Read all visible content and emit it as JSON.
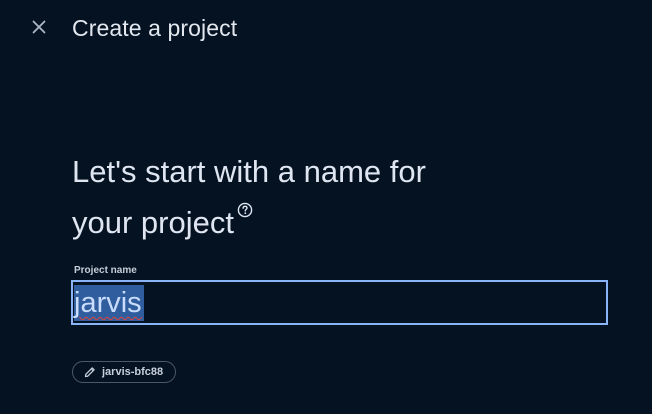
{
  "topbar": {
    "title": "Create a project",
    "close_icon": "close-icon"
  },
  "main": {
    "headline_line1": "Let's start with a name for",
    "headline_line2": "your project",
    "help_icon": "help-circle-icon"
  },
  "project_name_field": {
    "label": "Project name",
    "value": "jarvis"
  },
  "project_id_chip": {
    "icon": "pencil-icon",
    "label": "jarvis-bfc88"
  },
  "colors": {
    "background": "#041221",
    "accent": "#8ab4f8",
    "selection": "#2f5d9e",
    "spellcheck": "#e0443c"
  }
}
